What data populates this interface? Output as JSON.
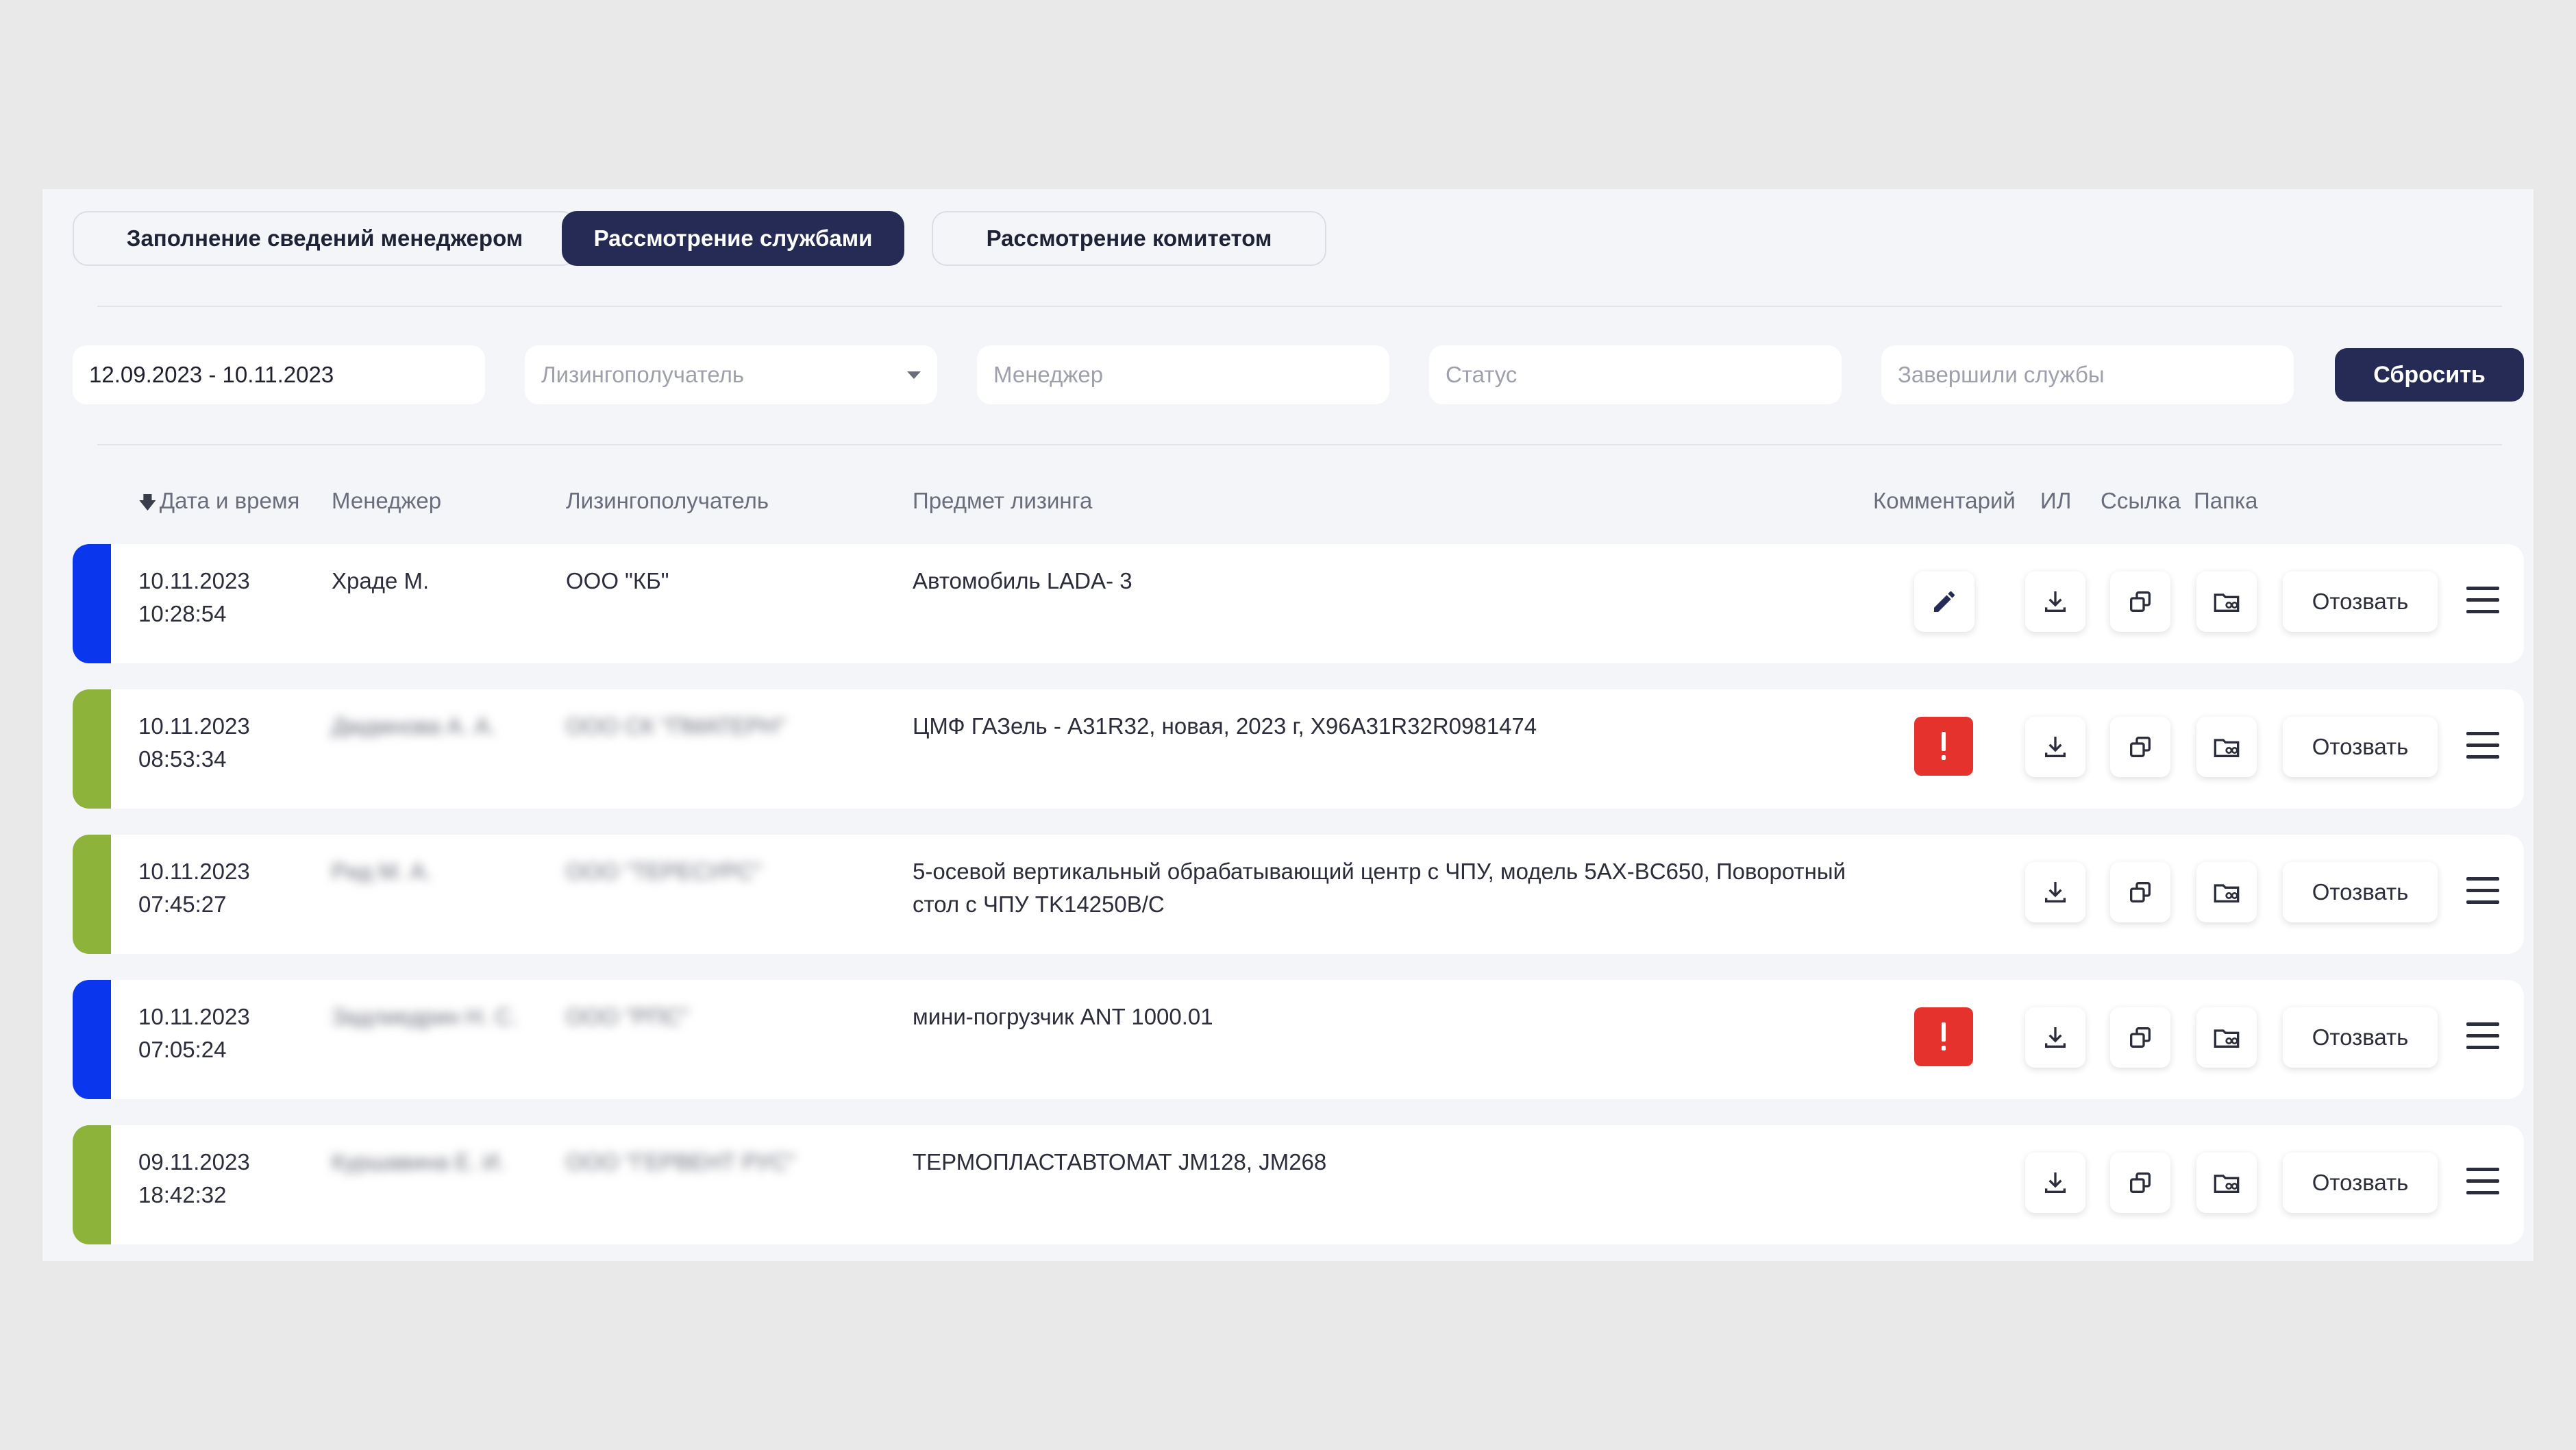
{
  "tabs": [
    {
      "label": "Заполнение сведений менеджером",
      "active": false
    },
    {
      "label": "Рассмотрение службами",
      "active": true
    },
    {
      "label": "Рассмотрение комитетом",
      "active": false
    }
  ],
  "filters": {
    "date_range": "12.09.2023 - 10.11.2023",
    "lessee_placeholder": "Лизингополучатель",
    "manager_placeholder": "Менеджер",
    "status_placeholder": "Статус",
    "completed_placeholder": "Завершили службы",
    "reset_label": "Сбросить"
  },
  "columns": {
    "datetime": "Дата и время",
    "manager": "Менеджер",
    "lessee": "Лизингополучатель",
    "subject": "Предмет лизинга",
    "comment": "Комментарий",
    "il": "ИЛ",
    "link": "Ссылка",
    "folder": "Папка"
  },
  "colors": {
    "accent_dark": "#262b55",
    "stripe_blue": "#0a37ee",
    "stripe_green": "#8db33a",
    "warning": "#e5322d"
  },
  "rows": [
    {
      "date": "10.11.2023",
      "time": "10:28:54",
      "manager": "Храде М.",
      "lessee": "ООО \"КБ\"",
      "subject": "Автомобиль LADA- 3",
      "subject_line2": "",
      "stripe": "blue",
      "comment": "pencil-icon",
      "recall": "Отозвать"
    },
    {
      "date": "10.11.2023",
      "time": "08:53:34",
      "manager": "Дмдмнова А. А.",
      "lessee": "ООО СК \"ПМАТЕРН\"",
      "subject": "ЦМФ ГАЗель - А31R32, новая, 2023 г, X96А31R32R0981474",
      "subject_line2": "",
      "stripe": "green",
      "comment": "warning-icon",
      "recall": "Отозвать"
    },
    {
      "date": "10.11.2023",
      "time": "07:45:27",
      "manager": "Рид М. А.",
      "lessee": "ООО \"ТЕРЕСУРС\"",
      "subject": "5-осевой вертикальный обрабатывающий центр с ЧПУ, модель 5AX-BC650, Поворотный",
      "subject_line2": "стол с ЧПУ TK14250B/C",
      "stripe": "green",
      "comment": "",
      "recall": "Отозвать"
    },
    {
      "date": "10.11.2023",
      "time": "07:05:24",
      "manager": "Задлиедрин Н. С.",
      "lessee": "ООО \"РПС\"",
      "subject": "мини-погрузчик ANT 1000.01",
      "subject_line2": "",
      "stripe": "blue",
      "comment": "warning-icon",
      "recall": "Отозвать"
    },
    {
      "date": "09.11.2023",
      "time": "18:42:32",
      "manager": "Куршавина Е. И.",
      "lessee": "ООО \"ГЕРВЕНТ РУС\"",
      "subject": "ТЕРМОПЛАСТАВТОМАТ JM128, JM268",
      "subject_line2": "",
      "stripe": "green",
      "comment": "",
      "recall": "Отозвать"
    }
  ]
}
